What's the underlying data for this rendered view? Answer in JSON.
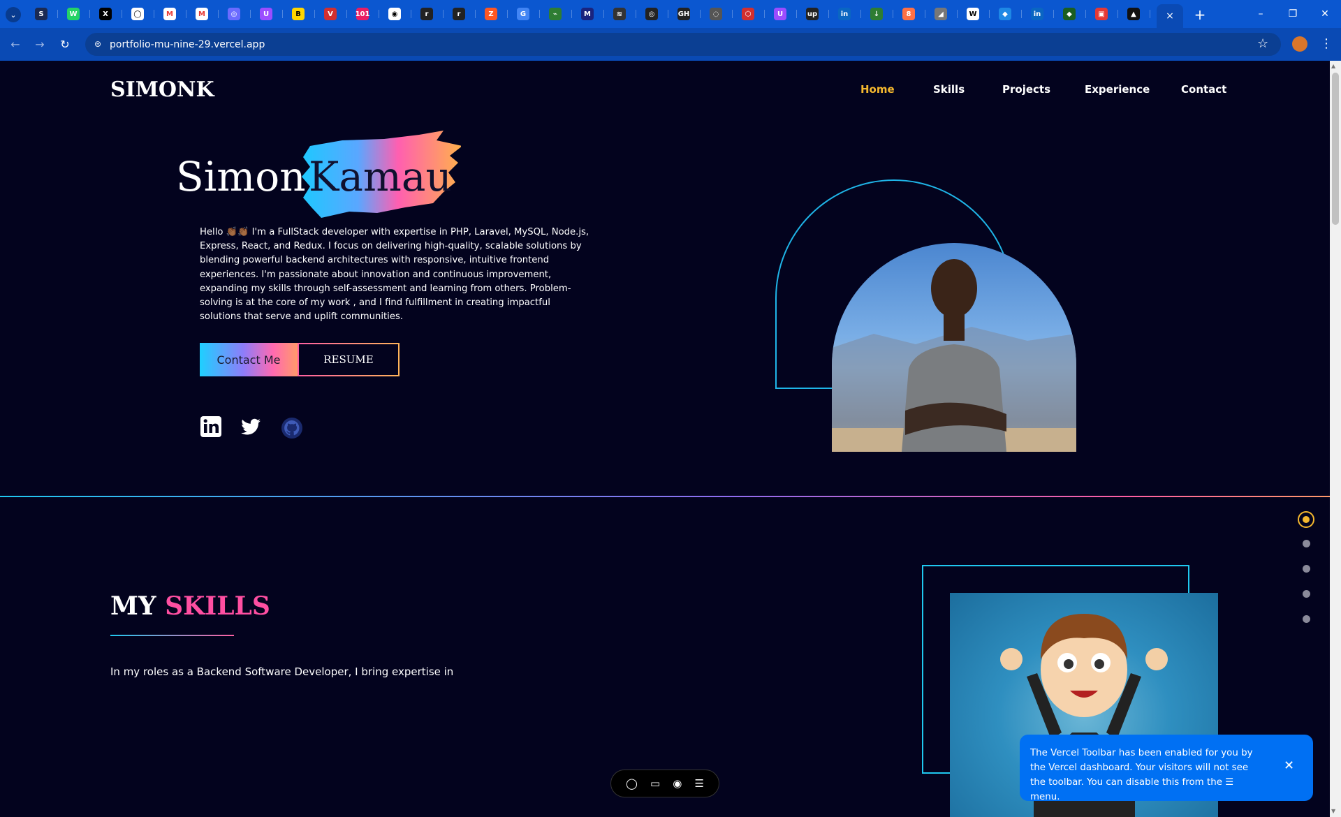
{
  "browser": {
    "tab_strip_icons": [
      "S",
      "W",
      "X",
      "◯",
      "M",
      "M",
      "◎",
      "U",
      "B",
      "V",
      "101",
      "◉",
      "r",
      "r",
      "Z",
      "G",
      "⌁",
      "M",
      "≋",
      "◎",
      "GH",
      "◌",
      "⬡",
      "U",
      "up",
      "in",
      "↓",
      "8",
      "◢",
      "W",
      "◆",
      "in",
      "◆",
      "▣",
      "▲"
    ],
    "active_tab_close": "×",
    "new_tab": "+",
    "window_controls": [
      "–",
      "❐",
      "✕"
    ],
    "back": "←",
    "forward": "→",
    "reload": "↻",
    "site_info": "⊜",
    "url": "portfolio-mu-nine-29.vercel.app",
    "bookmark_icon": "☆",
    "menu_icon": "⋮"
  },
  "site": {
    "logo": "SIMONK",
    "nav": [
      {
        "label": "Home",
        "active": true
      },
      {
        "label": "Skills",
        "active": false
      },
      {
        "label": "Projects",
        "active": false
      },
      {
        "label": "Experience",
        "active": false
      },
      {
        "label": "Contact",
        "active": false
      }
    ]
  },
  "hero": {
    "first_name": "Simon",
    "last_name": "Kamau",
    "bio": "Hello 👏🏾👏🏾 I'm a FullStack developer with expertise in PHP, Laravel, MySQL, Node.js, Express, React, and Redux. I focus on delivering high-quality, scalable solutions by blending powerful backend architectures with responsive, intuitive frontend experiences. I'm passionate about innovation and continuous improvement, expanding my skills through self-assessment and learning from others. Problem-solving is at the core of my work , and I find fulfillment in creating impactful solutions that serve and uplift communities.",
    "contact_button": "Contact Me",
    "resume_button": "RESUME"
  },
  "skills": {
    "title_part1": "MY",
    "title_part2": "SKILLS",
    "intro": "In my roles as a Backend Software Developer, I bring expertise in"
  },
  "vercel": {
    "toast": "The Vercel Toolbar has been enabled for you by the Vercel dashboard. Your visitors will not see the toolbar. You can disable this from the ☰ menu.",
    "toast_close": "✕",
    "toolbar_icons": [
      "comment-icon",
      "inbox-icon",
      "eye-icon",
      "menu-icon"
    ]
  },
  "colors": {
    "accent_yellow": "#f5b82e",
    "accent_pink": "#ff4fa2",
    "accent_cyan": "#1fc8f0",
    "page_bg": "#03031e",
    "chrome_blue": "#0b57d0",
    "toast_blue": "#0070f3"
  }
}
